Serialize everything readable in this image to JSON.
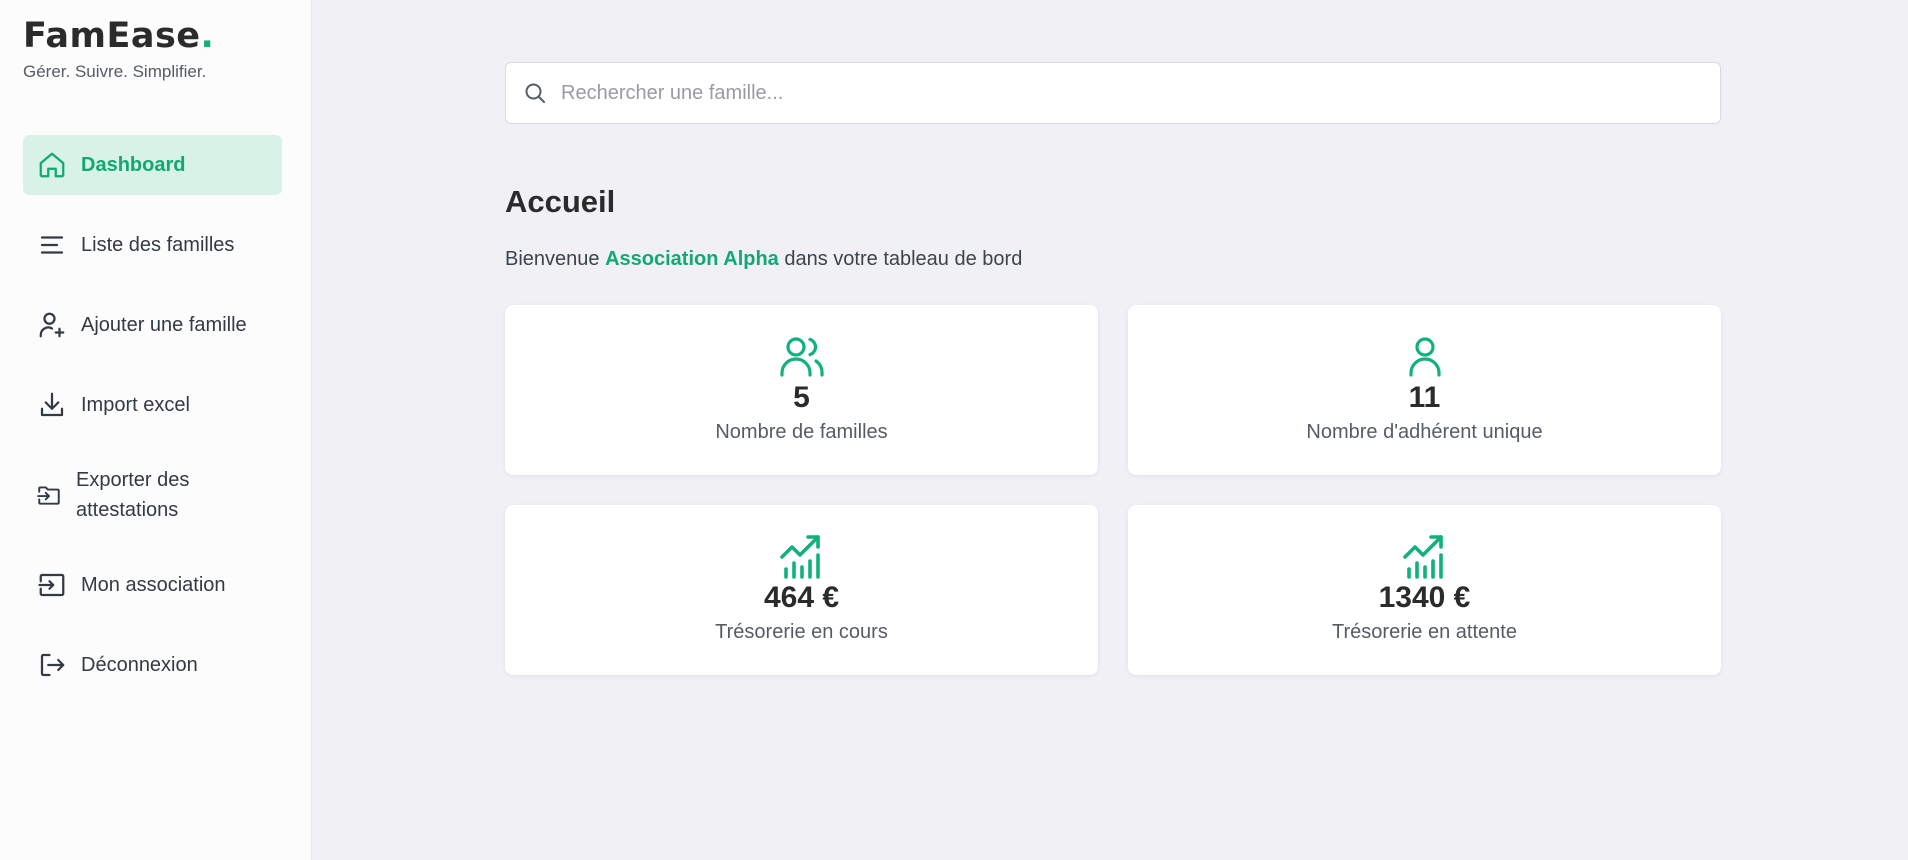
{
  "brand": {
    "name": "FamEase",
    "dot": ".",
    "tagline": "Gérer. Suivre. Simplifier."
  },
  "sidebar": {
    "items": [
      {
        "label": "Dashboard",
        "icon": "home-icon",
        "active": true
      },
      {
        "label": "Liste des familles",
        "icon": "list-icon"
      },
      {
        "label": "Ajouter une famille",
        "icon": "user-plus-icon"
      },
      {
        "label": "Import excel",
        "icon": "download-icon"
      },
      {
        "label": "Exporter des attestations",
        "icon": "export-icon"
      },
      {
        "label": "Mon association",
        "icon": "login-icon"
      },
      {
        "label": "Déconnexion",
        "icon": "logout-icon"
      }
    ]
  },
  "search": {
    "placeholder": "Rechercher une famille...",
    "value": ""
  },
  "main": {
    "title": "Accueil",
    "welcome_prefix": "Bienvenue ",
    "organization": "Association Alpha",
    "welcome_suffix": " dans votre tableau de bord"
  },
  "stats": [
    {
      "value": "5",
      "label": "Nombre de familles",
      "icon": "users-icon"
    },
    {
      "value": "11",
      "label": "Nombre d'adhérent unique",
      "icon": "user-icon"
    },
    {
      "value": "464 €",
      "label": "Trésorerie en cours",
      "icon": "chart-trend-icon"
    },
    {
      "value": "1340 €",
      "label": "Trésorerie en attente",
      "icon": "chart-trend-icon"
    }
  ],
  "colors": {
    "accent": "#10b27a",
    "active_bg": "#d9f2e8",
    "background": "#f1f1f5"
  }
}
